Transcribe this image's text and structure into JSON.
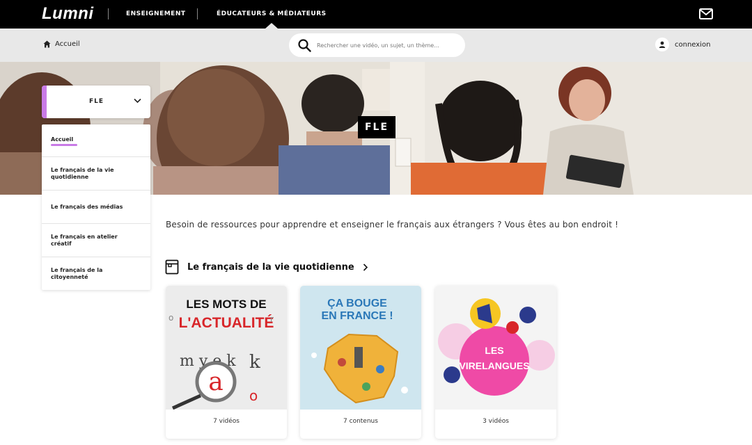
{
  "topbar": {
    "logo": "Lumni",
    "nav": [
      {
        "label": "ENSEIGNEMENT"
      },
      {
        "label": "ÉDUCATEURS & MÉDIATEURS"
      }
    ]
  },
  "subbar": {
    "home_label": "Accueil",
    "search_placeholder": "Rechercher une vidéo, un sujet, un thème...",
    "login_label": "connexion"
  },
  "hero": {
    "title": "FLE"
  },
  "dropdown": {
    "selected": "FLE",
    "accent_color": "#c97ae6"
  },
  "sidemenu": {
    "items": [
      {
        "label": "Accueil"
      },
      {
        "label": "Le français de la vie quotidienne"
      },
      {
        "label": "Le français des médias"
      },
      {
        "label": "Le français en atelier créatif"
      },
      {
        "label": "Le français de la citoyenneté"
      }
    ]
  },
  "main": {
    "intro": "Besoin de ressources pour apprendre et enseigner le français aux étrangers ? Vous êtes au bon endroit !",
    "section_title": "Le français de la vie quotidienne"
  },
  "cards": [
    {
      "thumb_lines": [
        "LES MOTS DE",
        "L'ACTUALITÉ"
      ],
      "count": "7 vidéos"
    },
    {
      "thumb_lines": [
        "ÇA BOUGE",
        "EN FRANCE !"
      ],
      "count": "7 contenus"
    },
    {
      "thumb_lines": [
        "LES",
        "VIRELANGUES"
      ],
      "count": "3 vidéos"
    }
  ]
}
